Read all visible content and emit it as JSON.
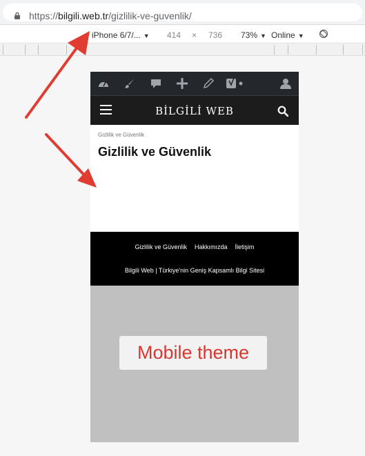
{
  "browser": {
    "url_scheme": "https://",
    "url_domain": "bilgili.web.tr",
    "url_path": "/gizlilik-ve-guvenlik/"
  },
  "devtools": {
    "device": "iPhone 6/7/...",
    "width": "414",
    "times": "×",
    "height": "736",
    "zoom": "73%",
    "network": "Online"
  },
  "site": {
    "logo": "BİLGİLİ WEB",
    "breadcrumb": "Gizlilik ve Güvenlik",
    "page_title": "Gizlilik ve Güvenlik",
    "footer_links": [
      "Gizlilik ve Güvenlik",
      "Hakkımızda",
      "İletişim"
    ],
    "footer_text": "Bilgili Web | Türkiye'nin Geniş Kapsamlı Bilgi Sitesi"
  },
  "overlay": {
    "badge": "Mobile theme",
    "badge_color": "#d9362f",
    "arrow_color": "#e03c31"
  }
}
